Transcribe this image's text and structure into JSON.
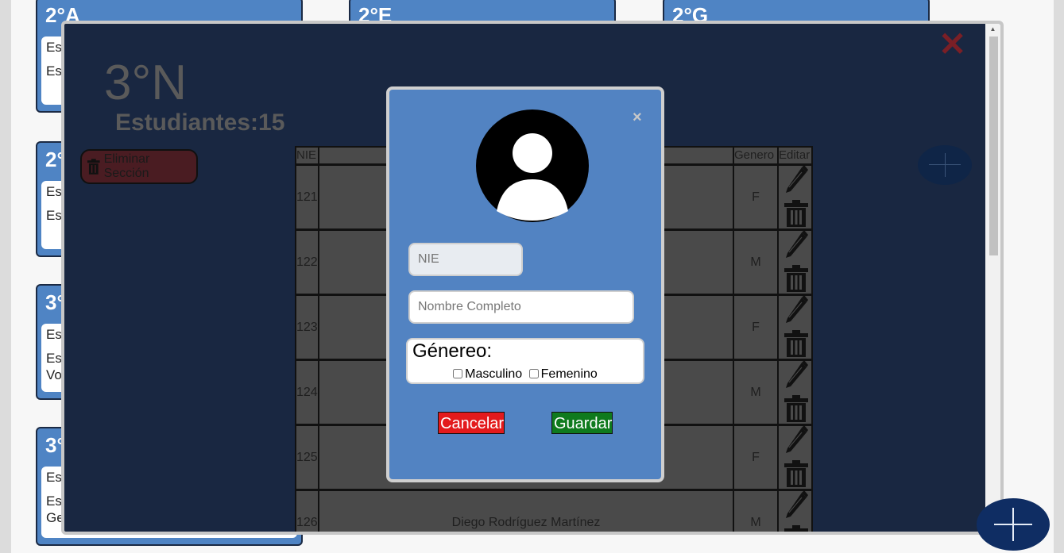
{
  "background_cards": [
    {
      "title": "2°A",
      "lines": [
        "Es",
        "Es"
      ]
    },
    {
      "title": "2°E",
      "lines": []
    },
    {
      "title": "2°G",
      "lines": []
    },
    {
      "title": "2°",
      "lines": [
        "Es",
        "Es"
      ]
    },
    {
      "title": "3°",
      "lines": [
        "Es",
        "Es",
        "Vo"
      ]
    },
    {
      "title": "3°",
      "lines": [
        "Es",
        "Es",
        "Ge"
      ]
    }
  ],
  "section": {
    "title": "3°N",
    "students_count": "Estudiantes:15",
    "delete_label": "Eliminar Sección"
  },
  "table": {
    "headers": {
      "nie": "NIE",
      "name": "",
      "gender": "Genero",
      "edit": "Editar"
    },
    "rows": [
      {
        "nie": "121",
        "name": "",
        "gender": "F"
      },
      {
        "nie": "122",
        "name": "",
        "gender": "M"
      },
      {
        "nie": "123",
        "name": "",
        "gender": "F"
      },
      {
        "nie": "124",
        "name": "",
        "gender": "M"
      },
      {
        "nie": "125",
        "name": "",
        "gender": "F"
      },
      {
        "nie": "126",
        "name": "Diego Rodríguez Martínez",
        "gender": "M"
      }
    ]
  },
  "modal": {
    "close_glyph": "×",
    "nie_placeholder": "NIE",
    "name_placeholder": "Nombre Completo",
    "gender_label": "Génereo:",
    "option_male": "Masculino",
    "option_female": "Femenino",
    "cancel_label": "Cancelar",
    "save_label": "Guardar"
  },
  "overlay_close_glyph": "✕",
  "colors": {
    "card_blue": "#4f84c4",
    "overlay_bg": "#192741",
    "modal_bg": "#5283c2",
    "cancel_bg": "#e31a1c",
    "save_bg": "#0f7a1d",
    "delete_bg": "#4a1c22"
  }
}
